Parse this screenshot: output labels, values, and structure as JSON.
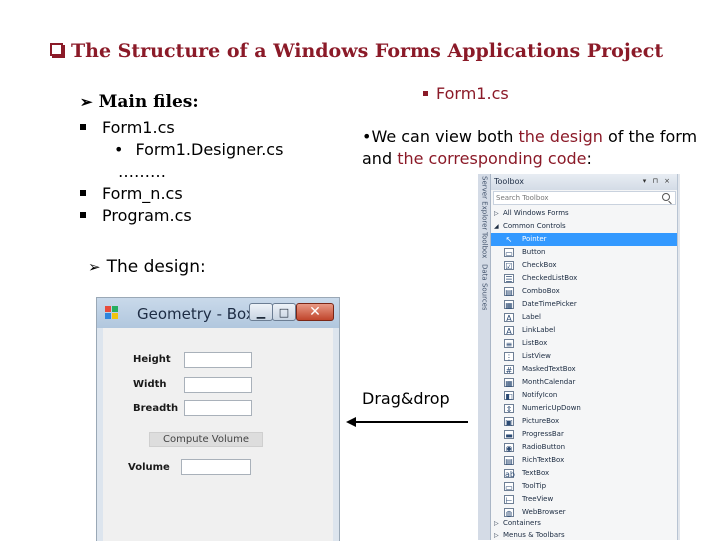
{
  "slide": {
    "title": "The Structure of a Windows Forms Applications Project",
    "main_files_heading": "Main files:",
    "files": [
      {
        "name": "Form1.cs",
        "bullet": "square"
      },
      {
        "name": "Form1.Designer.cs",
        "bullet": "dot"
      },
      {
        "name": "………",
        "bullet": "none"
      },
      {
        "name": "Form_n.cs",
        "bullet": "square"
      },
      {
        "name": "Program.cs",
        "bullet": "square"
      }
    ],
    "right_heading": "Form1.cs",
    "description_parts": [
      "We can view both ",
      "the design",
      " of the form and ",
      "the corresponding code",
      ":"
    ],
    "design_heading": "The design:",
    "drag_label": "Drag&drop",
    "accent_color": "#8b1a28"
  },
  "form_window": {
    "title": "Geometry - Box",
    "labels": {
      "height": "Height",
      "width": "Width",
      "breadth": "Breadth",
      "volume": "Volume"
    },
    "compute_button": "Compute Volume",
    "minimize_icon": "minimize-icon",
    "maximize_icon": "maximize-icon",
    "close_icon": "close-icon"
  },
  "toolbox": {
    "title": "Toolbox",
    "header_controls": "▾ ⊓ ×",
    "search_placeholder": "Search Toolbox",
    "side_tabs": [
      "Server Explorer",
      "Toolbox",
      "Data Sources"
    ],
    "groups": {
      "all": "All Windows Forms",
      "common": "Common Controls",
      "containers": "Containers",
      "menus": "Menus & Toolbars"
    },
    "items": [
      {
        "label": "Pointer",
        "icon": "pointer-icon",
        "glyph": "↖",
        "selected": true
      },
      {
        "label": "Button",
        "icon": "button-icon",
        "glyph": "▭",
        "selected": false
      },
      {
        "label": "CheckBox",
        "icon": "checkbox-icon",
        "glyph": "☑",
        "selected": false
      },
      {
        "label": "CheckedListBox",
        "icon": "checkedlistbox-icon",
        "glyph": "☰",
        "selected": false
      },
      {
        "label": "ComboBox",
        "icon": "combobox-icon",
        "glyph": "▤",
        "selected": false
      },
      {
        "label": "DateTimePicker",
        "icon": "datetimepicker-icon",
        "glyph": "▦",
        "selected": false
      },
      {
        "label": "Label",
        "icon": "label-icon",
        "glyph": "A",
        "selected": false
      },
      {
        "label": "LinkLabel",
        "icon": "linklabel-icon",
        "glyph": "A",
        "selected": false
      },
      {
        "label": "ListBox",
        "icon": "listbox-icon",
        "glyph": "≡",
        "selected": false
      },
      {
        "label": "ListView",
        "icon": "listview-icon",
        "glyph": "⋮",
        "selected": false
      },
      {
        "label": "MaskedTextBox",
        "icon": "maskedtextbox-icon",
        "glyph": "#",
        "selected": false
      },
      {
        "label": "MonthCalendar",
        "icon": "monthcalendar-icon",
        "glyph": "▦",
        "selected": false
      },
      {
        "label": "NotifyIcon",
        "icon": "notifyicon-icon",
        "glyph": "◧",
        "selected": false
      },
      {
        "label": "NumericUpDown",
        "icon": "numericupdown-icon",
        "glyph": "⇕",
        "selected": false
      },
      {
        "label": "PictureBox",
        "icon": "picturebox-icon",
        "glyph": "▣",
        "selected": false
      },
      {
        "label": "ProgressBar",
        "icon": "progressbar-icon",
        "glyph": "▬",
        "selected": false
      },
      {
        "label": "RadioButton",
        "icon": "radiobutton-icon",
        "glyph": "◉",
        "selected": false
      },
      {
        "label": "RichTextBox",
        "icon": "richtextbox-icon",
        "glyph": "▤",
        "selected": false
      },
      {
        "label": "TextBox",
        "icon": "textbox-icon",
        "glyph": "ab",
        "selected": false
      },
      {
        "label": "ToolTip",
        "icon": "tooltip-icon",
        "glyph": "▭",
        "selected": false
      },
      {
        "label": "TreeView",
        "icon": "treeview-icon",
        "glyph": "⊢",
        "selected": false
      },
      {
        "label": "WebBrowser",
        "icon": "webbrowser-icon",
        "glyph": "◍",
        "selected": false
      }
    ]
  }
}
